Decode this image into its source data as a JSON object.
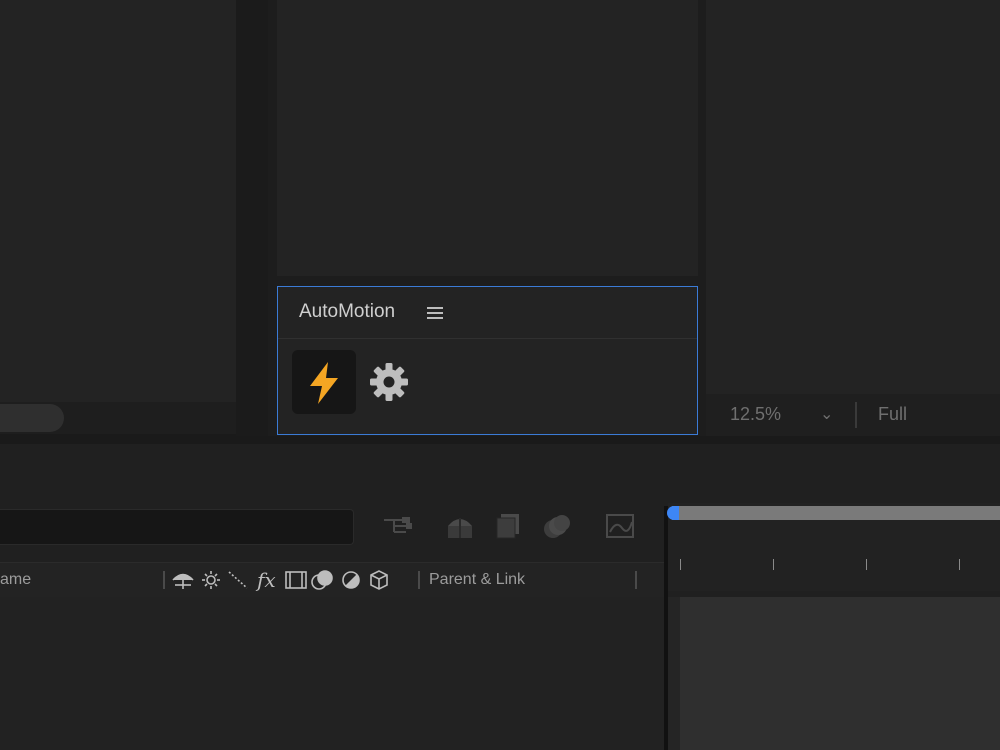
{
  "panel": {
    "title": "AutoMotion",
    "menu_icon": "hamburger-icon",
    "action_icon": "lightning-bolt-icon",
    "settings_icon": "gear-icon",
    "accent_color": "#f5a623",
    "border_color": "#3b7bd6"
  },
  "viewer": {
    "zoom": "12.5%",
    "zoom_chevron": "⌄",
    "resolution": "Full"
  },
  "timeline": {
    "columns": {
      "name": "ame",
      "parent": "Parent & Link"
    },
    "toolbar_icons": [
      "flowchart-icon",
      "shy-layers-icon",
      "frame-blending-icon",
      "motion-blur-icon",
      "graph-editor-icon"
    ],
    "switch_icons": [
      "shy-icon",
      "collapse-icon",
      "quality-icon",
      "fx-icon",
      "frame-blend-icon",
      "motion-blur-icon",
      "adjustment-icon",
      "3d-layer-icon"
    ],
    "playhead_color": "#3d86f5"
  }
}
